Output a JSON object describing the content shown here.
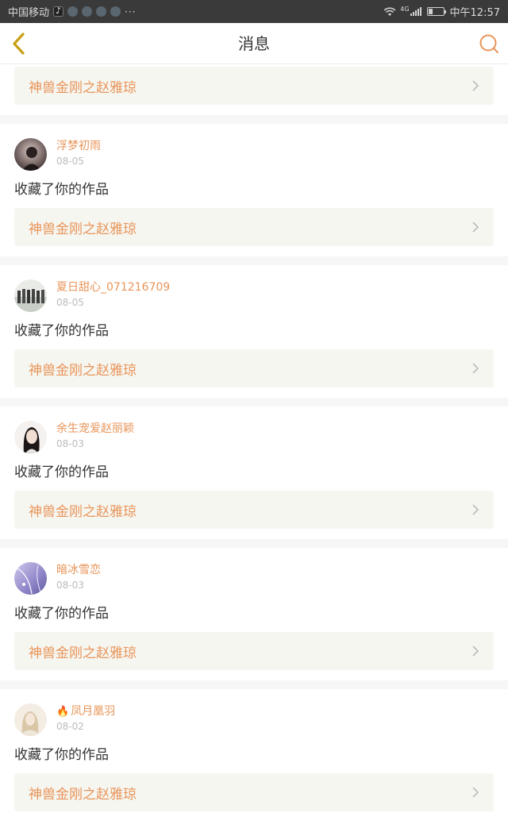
{
  "status_bar": {
    "carrier": "中国移动",
    "network": "4G",
    "time": "中午12:57",
    "overflow": "···",
    "battery_level": 0.3
  },
  "header": {
    "title": "消息",
    "back_icon": "chevron-left-icon",
    "search_icon": "search-icon"
  },
  "colors": {
    "accent": "#e8955a",
    "back_arrow": "#c8a017",
    "link_bg": "#f6f6f1",
    "divider": "#f6f6f1"
  },
  "partial_card": {
    "work_title": "神兽金刚之赵雅琼"
  },
  "messages": [
    {
      "username": "浮梦初雨",
      "date": "08-05",
      "action": "收藏了你的作品",
      "work_title": "神兽金刚之赵雅琼",
      "has_fire": false
    },
    {
      "username": "夏日甜心_071216709",
      "date": "08-05",
      "action": "收藏了你的作品",
      "work_title": "神兽金刚之赵雅琼",
      "has_fire": false
    },
    {
      "username": "余生宠爱赵丽颖",
      "date": "08-03",
      "action": "收藏了你的作品",
      "work_title": "神兽金刚之赵雅琼",
      "has_fire": false
    },
    {
      "username": "暗冰雪恋",
      "date": "08-03",
      "action": "收藏了你的作品",
      "work_title": "神兽金刚之赵雅琼",
      "has_fire": false
    },
    {
      "username": "凤月凰羽",
      "date": "08-02",
      "action": "收藏了你的作品",
      "work_title": "神兽金刚之赵雅琼",
      "has_fire": true
    }
  ]
}
